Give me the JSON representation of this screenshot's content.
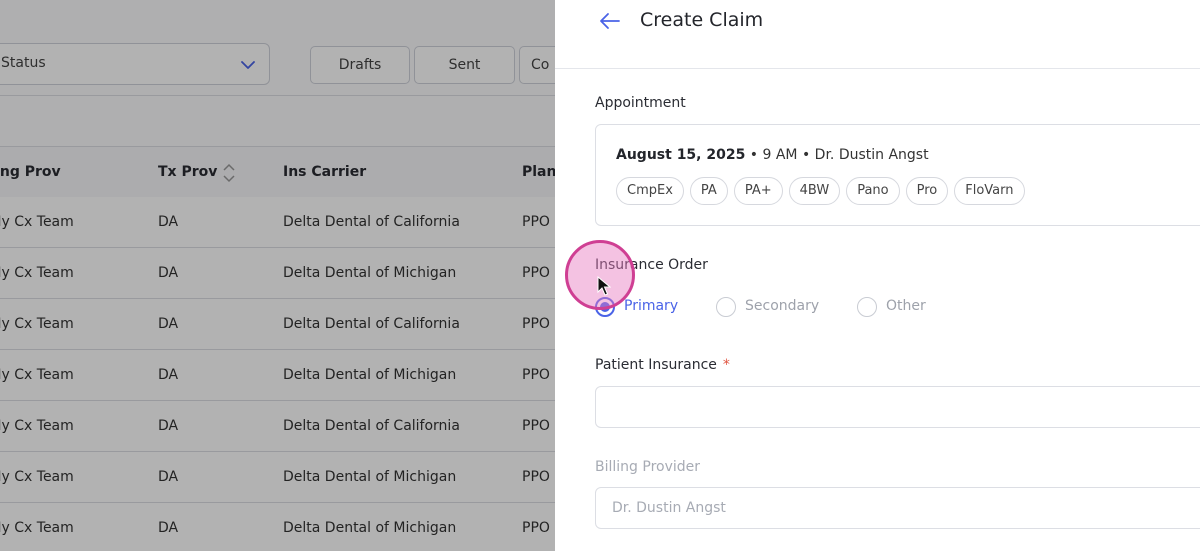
{
  "background": {
    "status_select": "Status",
    "segments": [
      "Drafts",
      "Sent",
      "Co"
    ],
    "columns": [
      "Billing Prov",
      "Tx Prov",
      "Ins Carrier",
      "Plan"
    ],
    "rows": [
      {
        "billing": "Hy Cx Team",
        "tx": "DA",
        "carrier": "Delta Dental of California",
        "plan": "PPO"
      },
      {
        "billing": "Hy Cx Team",
        "tx": "DA",
        "carrier": "Delta Dental of Michigan",
        "plan": "PPO"
      },
      {
        "billing": "Hy Cx Team",
        "tx": "DA",
        "carrier": "Delta Dental of California",
        "plan": "PPO"
      },
      {
        "billing": "Hy Cx Team",
        "tx": "DA",
        "carrier": "Delta Dental of Michigan",
        "plan": "PPO"
      },
      {
        "billing": "Hy Cx Team",
        "tx": "DA",
        "carrier": "Delta Dental of California",
        "plan": "PPO"
      },
      {
        "billing": "Hy Cx Team",
        "tx": "DA",
        "carrier": "Delta Dental of Michigan",
        "plan": "PPO"
      },
      {
        "billing": "Hy Cx Team",
        "tx": "DA",
        "carrier": "Delta Dental of Michigan",
        "plan": "PPO"
      }
    ]
  },
  "drawer": {
    "title": "Create Claim",
    "appointment": {
      "label": "Appointment",
      "date": "August 15, 2025",
      "details": " • 9 AM • Dr. Dustin Angst",
      "chips": [
        "CmpEx",
        "PA",
        "PA+",
        "4BW",
        "Pano",
        "Pro",
        "FloVarn"
      ]
    },
    "insurance_order": {
      "label": "Insurance Order",
      "options": [
        {
          "label": "Primary",
          "checked": true
        },
        {
          "label": "Secondary",
          "checked": false
        },
        {
          "label": "Other",
          "checked": false
        }
      ]
    },
    "patient_insurance": {
      "label": "Patient Insurance",
      "required_mark": "*",
      "value": ""
    },
    "billing_provider": {
      "label": "Billing Provider",
      "value": "Dr. Dustin Angst"
    }
  },
  "colors": {
    "accent": "#4a63e7",
    "required": "#e0533f",
    "click_highlight": "#cf3f93"
  }
}
